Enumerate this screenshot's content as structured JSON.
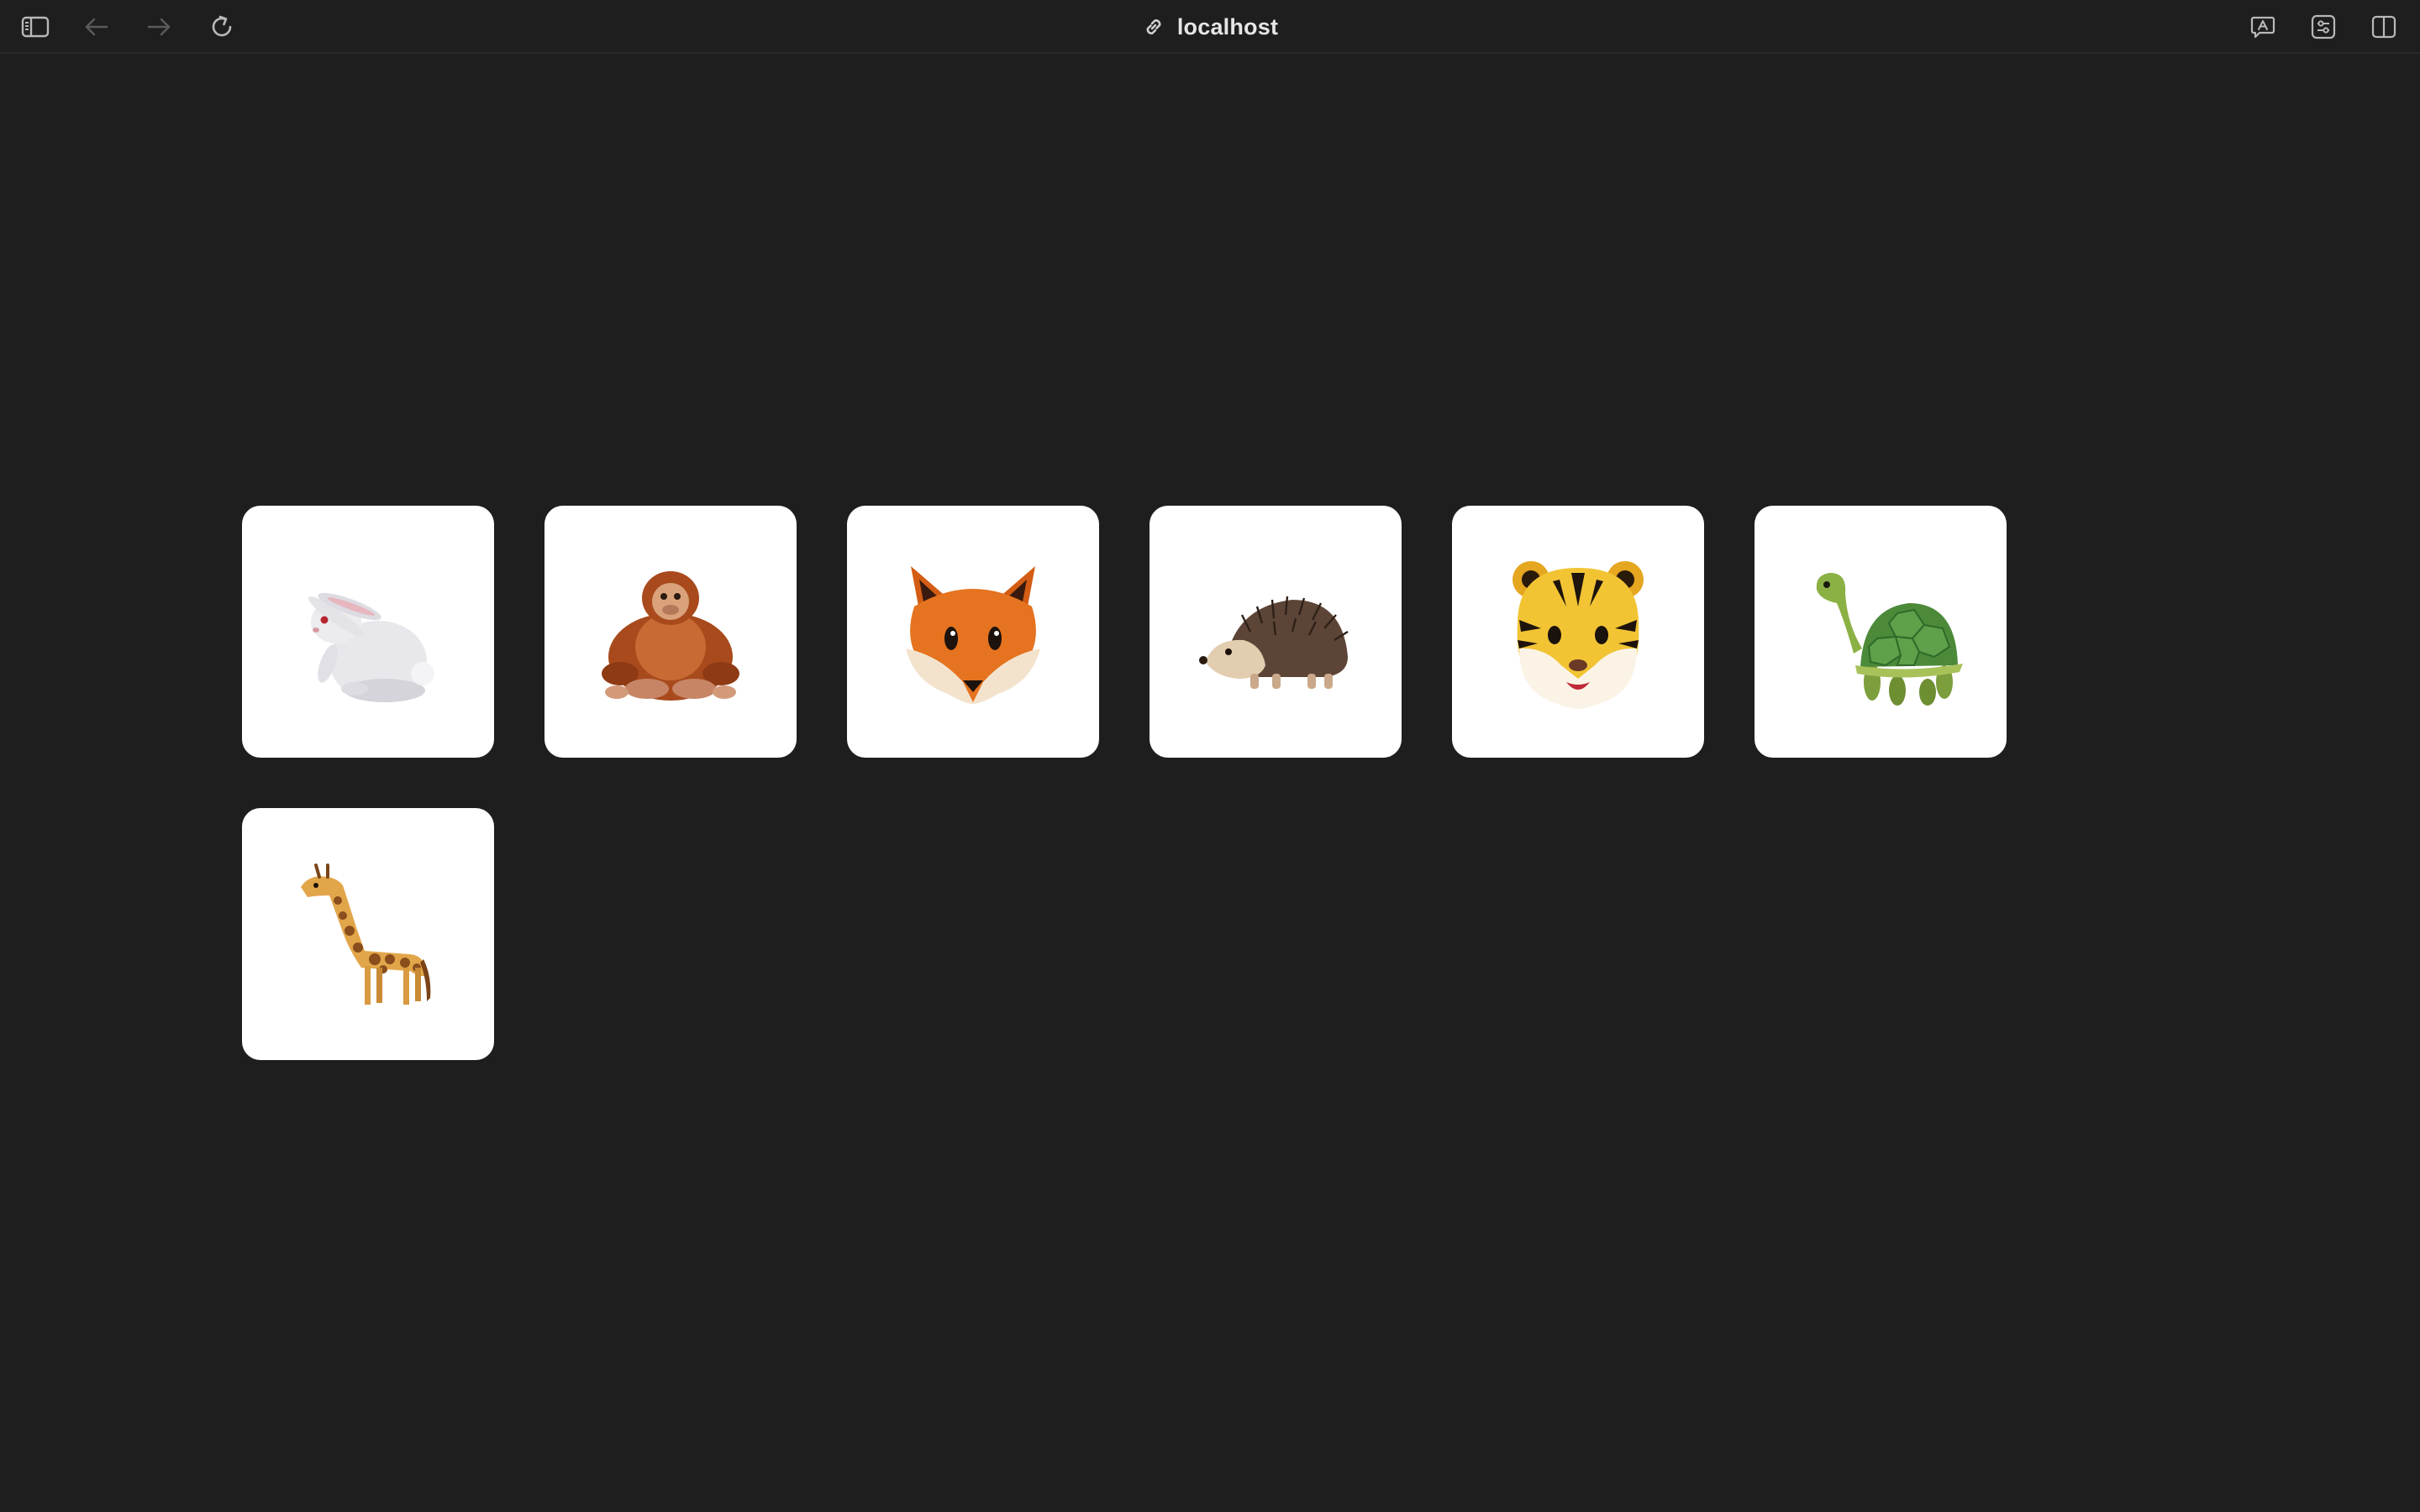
{
  "window": {
    "address": "localhost"
  },
  "toolbar": {
    "icons": [
      "sidebar-icon",
      "back-arrow-icon",
      "forward-arrow-icon",
      "reload-icon",
      "link-icon",
      "translate-icon",
      "page-settings-icon",
      "split-view-icon"
    ]
  },
  "cards": [
    {
      "animal": "rabbit-icon"
    },
    {
      "animal": "orangutan-icon"
    },
    {
      "animal": "fox-icon"
    },
    {
      "animal": "hedgehog-icon"
    },
    {
      "animal": "tiger-icon"
    },
    {
      "animal": "turtle-icon"
    },
    {
      "animal": "giraffe-icon"
    }
  ],
  "colors": {
    "background": "#1e1e1e",
    "card": "#ffffff",
    "toolbar_icon": "#b8b8b8",
    "toolbar_icon_disabled": "#5a5a5a"
  }
}
